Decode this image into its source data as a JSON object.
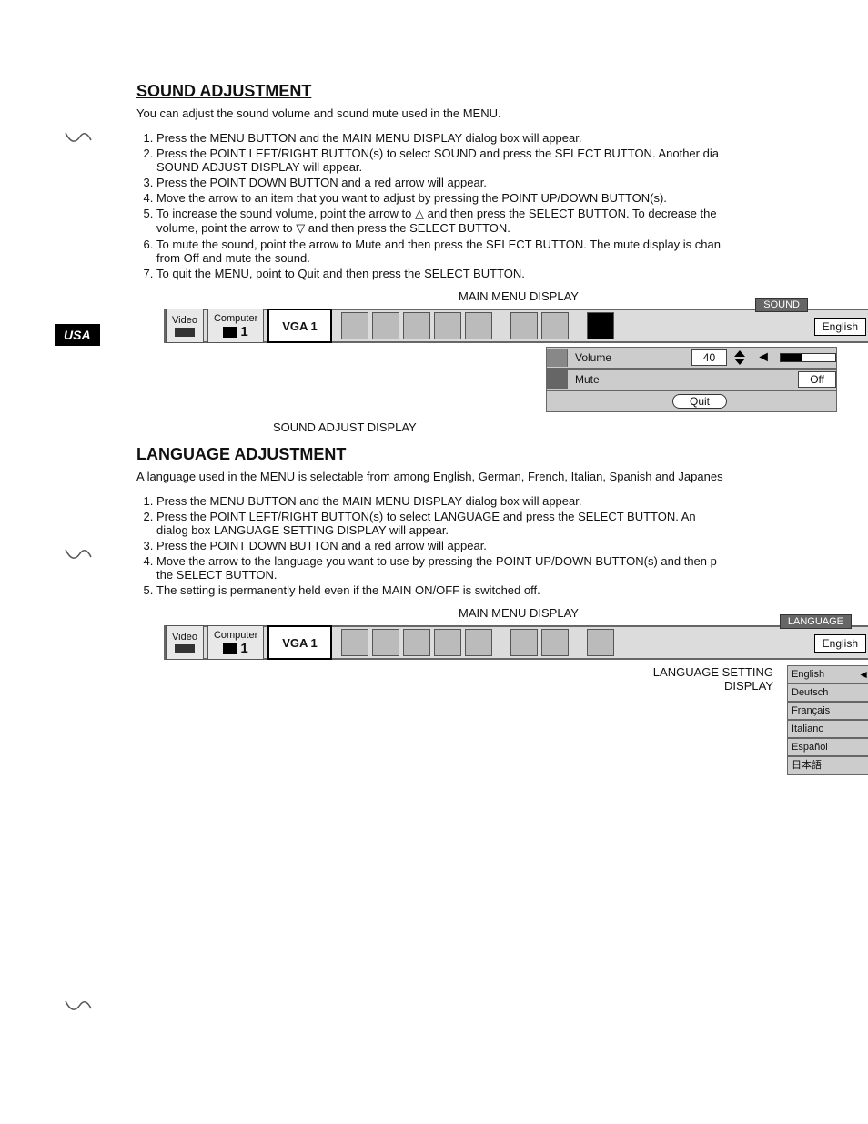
{
  "usa": "USA",
  "sound": {
    "title": "SOUND ADJUSTMENT",
    "intro": "You can adjust the sound volume and sound mute used in the MENU.",
    "steps": [
      "Press the MENU BUTTON and the MAIN MENU DISPLAY dialog box will appear.",
      "Press the POINT LEFT/RIGHT BUTTON(s) to select SOUND and press the SELECT BUTTON. Another dia",
      "Press the POINT DOWN BUTTON and a red arrow will appear.",
      "Move the arrow to an item that you want to adjust by pressing the POINT UP/DOWN BUTTON(s).",
      "To increase the sound volume, point the arrow to △ and then press the SELECT BUTTON. To decrease the",
      "To mute the sound, point the arrow to Mute and then press the SELECT BUTTON. The mute display is chan",
      "To quit the MENU, point to Quit and then press the SELECT BUTTON."
    ],
    "step2_sub": "SOUND ADJUST DISPLAY will appear.",
    "step5_sub": "volume, point the arrow to ▽ and then press the SELECT BUTTON.",
    "step6_sub": "from Off and mute the sound.",
    "menu_caption": "MAIN MENU DISPLAY",
    "tab_video": "Video",
    "tab_computer": "Computer",
    "tab_comp_num": "1",
    "tab_vga": "VGA 1",
    "sound_badge": "SOUND",
    "lang_sel": "English",
    "adjust_label": "SOUND ADJUST DISPLAY",
    "volume_label": "Volume",
    "volume_val": "40",
    "mute_label": "Mute",
    "mute_val": "Off",
    "quit_label": "Quit"
  },
  "lang": {
    "title": "LANGUAGE ADJUSTMENT",
    "intro": "A language used in the MENU is selectable from among English, German, French, Italian, Spanish and Japanes",
    "steps": [
      "Press the MENU BUTTON and the MAIN MENU DISPLAY dialog box will appear.",
      "Press the POINT LEFT/RIGHT BUTTON(s) to select LANGUAGE and press the SELECT BUTTON. An",
      "Press the POINT DOWN BUTTON and a red arrow will appear.",
      "Move the arrow to the language you want to use by pressing the POINT UP/DOWN BUTTON(s) and then p",
      "The setting is permanently held even if the MAIN ON/OFF is switched off."
    ],
    "step2_sub": "dialog box LANGUAGE SETTING DISPLAY will appear.",
    "step4_sub": "the SELECT BUTTON.",
    "menu_caption": "MAIN MENU DISPLAY",
    "tab_video": "Video",
    "tab_computer": "Computer",
    "tab_comp_num": "1",
    "tab_vga": "VGA 1",
    "lang_badge": "LANGUAGE",
    "lang_sel": "English",
    "setting_label": "LANGUAGE SETTING DISPLAY",
    "languages": [
      "English",
      "Deutsch",
      "Français",
      "Italiano",
      "Español",
      "日本語"
    ]
  }
}
